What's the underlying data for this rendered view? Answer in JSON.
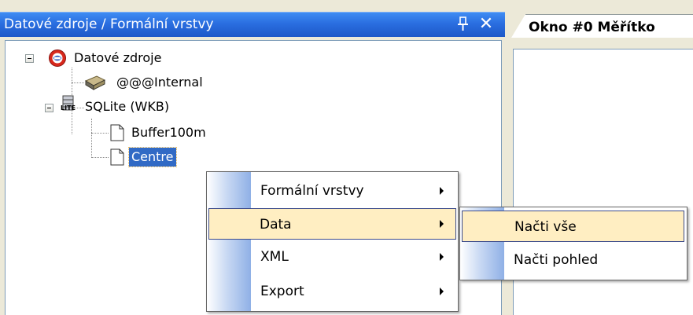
{
  "panel": {
    "title": "Datové zdroje / Formální vrstvy",
    "pin_glyph": "pin-icon",
    "close_glyph": "✕"
  },
  "tree": {
    "root": {
      "label": "Datové zdroje",
      "icon": "datasource-root-icon"
    },
    "internal": {
      "label": "@@@Internal",
      "icon": "database-brick-icon"
    },
    "sqlite": {
      "label": "SQLite (WKB)",
      "icon": "sqlite-icon",
      "icon_caption": "LITE",
      "children": [
        {
          "label": "Buffer100m",
          "icon": "document-icon"
        },
        {
          "label": "Centre",
          "icon": "document-icon",
          "selected": true
        }
      ]
    }
  },
  "document": {
    "tab_label": "Okno #0 Měřítko"
  },
  "context_menu": {
    "items": [
      {
        "label": "Formální vrstvy",
        "has_submenu": true
      },
      {
        "label": "Data",
        "has_submenu": true,
        "highlighted": true
      },
      {
        "label": "XML",
        "has_submenu": true
      },
      {
        "label": "Export",
        "has_submenu": true
      }
    ]
  },
  "submenu": {
    "items": [
      {
        "label": "Načti vše",
        "highlighted": true
      },
      {
        "label": "Načti pohled"
      }
    ]
  },
  "colors": {
    "title_bar": "#2a6ee0",
    "selection": "#316ac5",
    "menu_highlight": "#ffeec2",
    "window_bg": "#ece9d8"
  }
}
